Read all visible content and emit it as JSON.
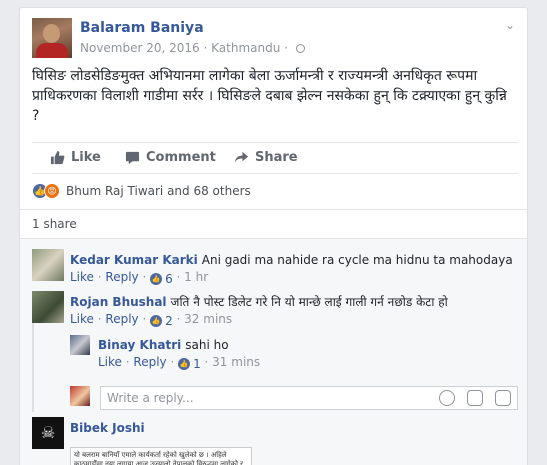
{
  "post": {
    "author": "Balaram Baniya",
    "date": "November 20, 2016",
    "separator": " · ",
    "location": "Kathmandu",
    "dot": " · ",
    "text": "घिसिङ लोडसेडिङमुक्त अभियानमा लागेका बेला ऊर्जामन्त्री र राज्यमन्त्री अनधिकृत रूपमा प्राधिकरणका विलाशी गाडीमा सर्रर । घिसिङले दबाब झेल्न नसकेका हुन् कि टक्र्याएका हुन् कुन्नि ?",
    "chevron": "⌄"
  },
  "actions": {
    "like": "Like",
    "comment": "Comment",
    "share": "Share"
  },
  "reactions": {
    "label": "Bhum Raj Tiwari and 68 others",
    "like_icon": "👍",
    "angry_icon": "😡"
  },
  "shares": "1 share",
  "comments": [
    {
      "author": "Kedar Kumar Karki",
      "text": "Ani gadi ma nahide ra cycle ma hidnu ta mahodaya",
      "like": "Like",
      "reply": "Reply",
      "count": "6",
      "time": "1 hr"
    },
    {
      "author": "Rojan Bhushal",
      "text": "जति नै पोस्ट डिलेट गरे नि यो मान्छे लाई गाली गर्न नछोड केटा हो",
      "like": "Like",
      "reply": "Reply",
      "count": "2",
      "time": "32 mins"
    },
    {
      "author": "Binay Khatri",
      "text": "sahi ho",
      "like": "Like",
      "reply": "Reply",
      "count": "1",
      "time": "31 mins"
    },
    {
      "author": "Bibek Joshi"
    }
  ],
  "reply_input": {
    "placeholder": "Write a reply..."
  },
  "dot_sep": " · ",
  "thumb_text": "यो बलराम बानियाँ एमाले कार्यकर्ता रहेको खुलेको छ । अहिले काठमाडौंमा नया लगाया आज उज्यालो नेपालको विरुद्धमा लागेको र"
}
